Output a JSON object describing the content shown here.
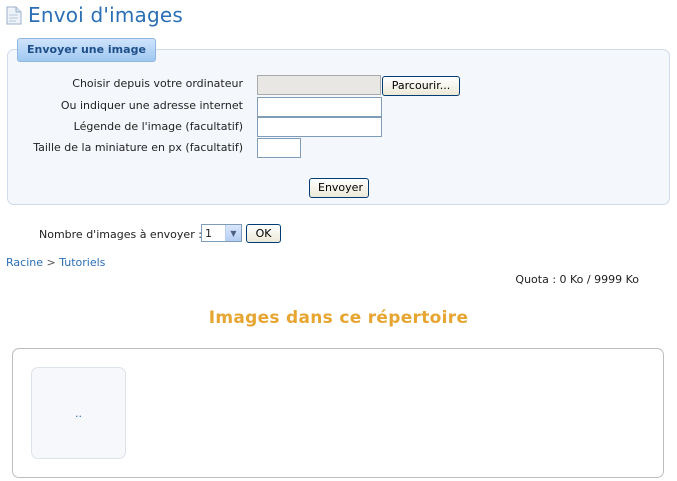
{
  "header": {
    "title": "Envoi d'images"
  },
  "upload": {
    "legend": "Envoyer une image",
    "labels": {
      "file": "Choisir depuis votre ordinateur",
      "url": "Ou indiquer une adresse internet",
      "caption": "Légende de l'image (facultatif)",
      "thumb": "Taille de la miniature en px (facultatif)"
    },
    "browse_label": "Parcourir...",
    "submit_label": "Envoyer"
  },
  "count": {
    "label": "Nombre d'images à envoyer :",
    "selected": "1",
    "ok_label": "OK"
  },
  "breadcrumb": {
    "root": "Racine",
    "separator": ">",
    "current": "Tutoriels"
  },
  "quota": {
    "text": "Quota : 0 Ko / 9999 Ko"
  },
  "gallery": {
    "title": "Images dans ce répertoire",
    "parent_label": ".."
  },
  "colors": {
    "title_blue": "#2b6fb5",
    "section_orange": "#e7a531"
  },
  "icons": {
    "page": "document-icon",
    "select_arrow": "chevron-down-icon"
  }
}
